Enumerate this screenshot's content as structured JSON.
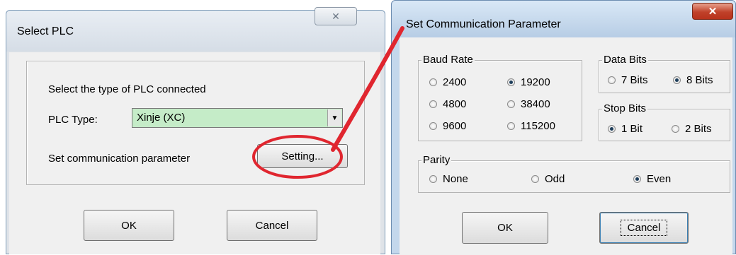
{
  "select_plc": {
    "title": "Select PLC",
    "prompt": "Select the type of PLC connected",
    "plc_type_label": "PLC Type:",
    "plc_type_value": "Xinje (XC)",
    "comm_label": "Set communication parameter",
    "setting_button": "Setting...",
    "ok_button": "OK",
    "cancel_button": "Cancel"
  },
  "comm_params": {
    "title": "Set Communication Parameter",
    "baud_rate": {
      "label": "Baud Rate",
      "options": [
        "2400",
        "19200",
        "4800",
        "38400",
        "9600",
        "115200"
      ],
      "selected": "19200"
    },
    "data_bits": {
      "label": "Data Bits",
      "options": [
        "7 Bits",
        "8 Bits"
      ],
      "selected": "8 Bits"
    },
    "stop_bits": {
      "label": "Stop Bits",
      "options": [
        "1 Bit",
        "2 Bits"
      ],
      "selected": "1 Bit"
    },
    "parity": {
      "label": "Parity",
      "options": [
        "None",
        "Odd",
        "Even"
      ],
      "selected": "Even"
    },
    "ok_button": "OK",
    "cancel_button": "Cancel"
  },
  "colors": {
    "annotation": "#e0262f",
    "combo_fill": "#c5ecc8",
    "close_button": "#c0412a"
  }
}
